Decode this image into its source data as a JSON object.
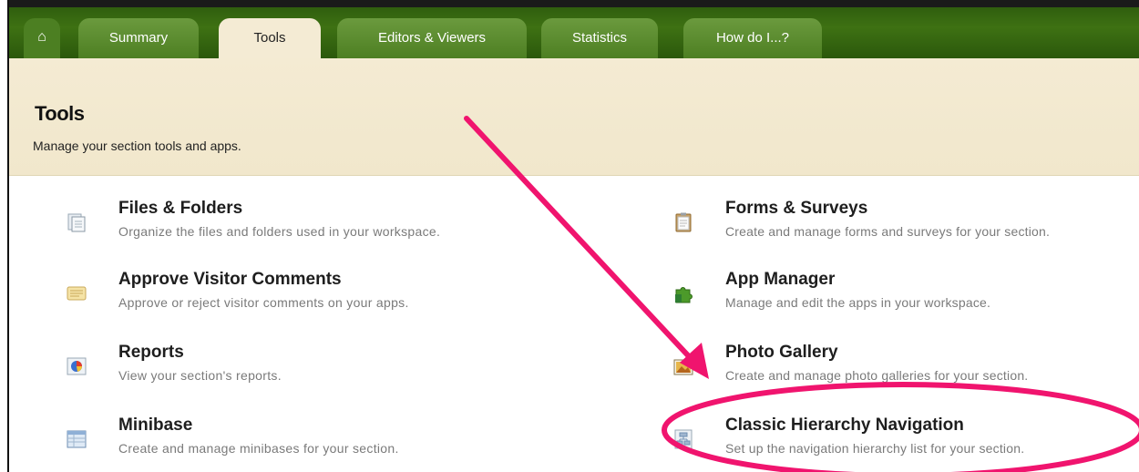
{
  "tabs": {
    "home_icon": "home-icon",
    "summary": "Summary",
    "tools": "Tools",
    "editors": "Editors & Viewers",
    "statistics": "Statistics",
    "howdo": "How do I...?"
  },
  "page": {
    "title": "Tools",
    "subtitle": "Manage your section tools and apps."
  },
  "tools_left": [
    {
      "title": "Files & Folders",
      "desc": "Organize the files and folders used in your workspace.",
      "icon": "files-folders-icon"
    },
    {
      "title": "Approve Visitor Comments",
      "desc": "Approve or reject visitor comments on your apps.",
      "icon": "comments-icon"
    },
    {
      "title": "Reports",
      "desc": "View your section's reports.",
      "icon": "reports-pie-icon"
    },
    {
      "title": "Minibase",
      "desc": "Create and manage minibases for your section.",
      "icon": "minibase-icon"
    }
  ],
  "tools_right": [
    {
      "title": "Forms & Surveys",
      "desc": "Create and manage forms and surveys for your section.",
      "icon": "clipboard-icon"
    },
    {
      "title": "App Manager",
      "desc": "Manage and edit the apps in your workspace.",
      "icon": "puzzle-icon"
    },
    {
      "title": "Photo Gallery",
      "desc": "Create and manage photo galleries for your section.",
      "icon": "photo-icon"
    },
    {
      "title": "Classic Hierarchy Navigation",
      "desc": "Set up the navigation hierarchy list for your section.",
      "icon": "hierarchy-icon"
    }
  ],
  "colors": {
    "nav_green": "#3e7113",
    "header_beige": "#f4ebd3",
    "annotation_pink": "#f0146e"
  }
}
